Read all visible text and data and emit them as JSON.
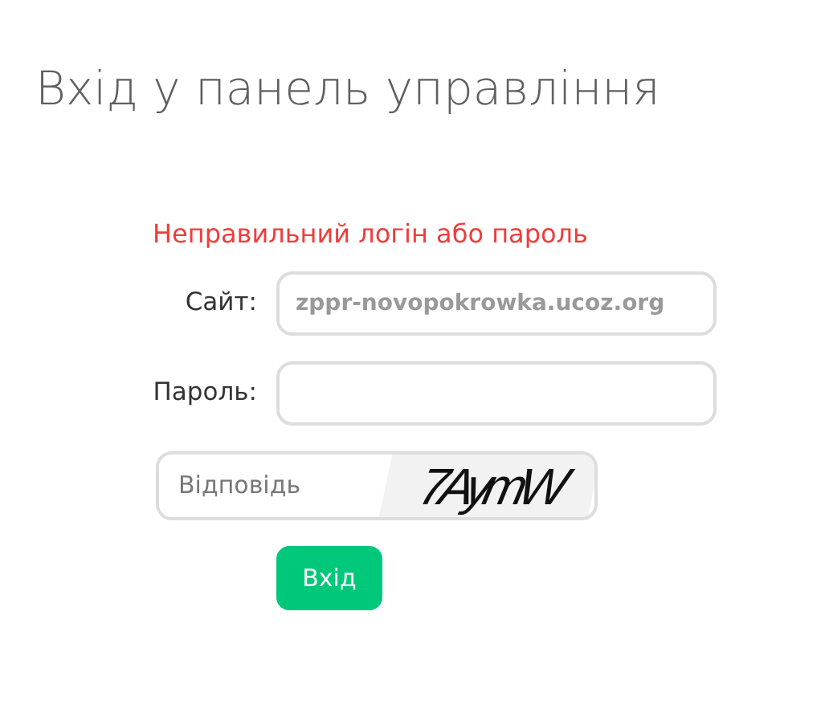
{
  "title": "Вхід у панель управління",
  "error": "Неправильний логін або пароль",
  "fields": [
    {
      "label": "Сайт:",
      "value": "zppr-novopokrowka.ucoz.org"
    },
    {
      "label": "Пароль:"
    }
  ],
  "captcha": {
    "placeholder": "Відповідь",
    "code": "7AymW"
  },
  "submit": "Вхід"
}
